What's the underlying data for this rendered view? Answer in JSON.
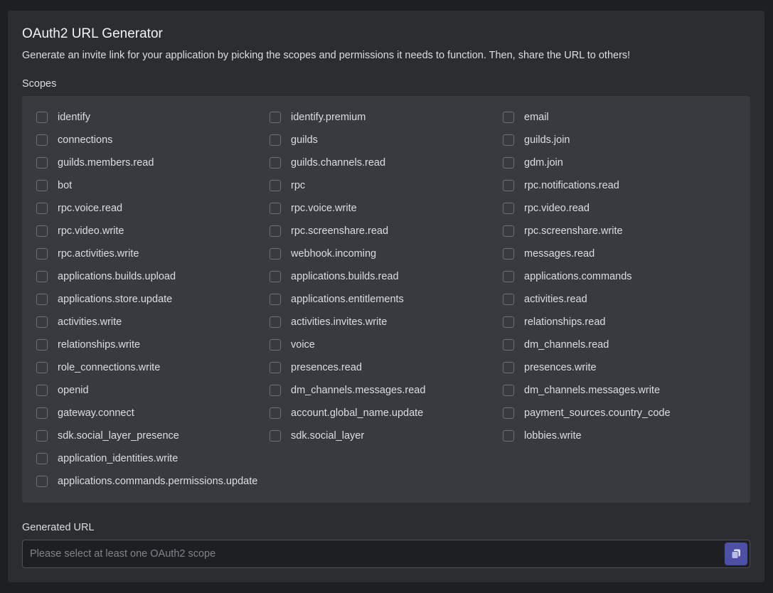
{
  "header": {
    "title": "OAuth2 URL Generator",
    "description": "Generate an invite link for your application by picking the scopes and permissions it needs to function. Then, share the URL to others!"
  },
  "scopes": {
    "label": "Scopes",
    "columns": [
      [
        "identify",
        "connections",
        "guilds.members.read",
        "bot",
        "rpc.voice.read",
        "rpc.video.write",
        "rpc.activities.write",
        "applications.builds.upload",
        "applications.store.update",
        "activities.write",
        "relationships.write",
        "role_connections.write",
        "openid",
        "gateway.connect",
        "sdk.social_layer_presence",
        "application_identities.write",
        "applications.commands.permissions.update"
      ],
      [
        "identify.premium",
        "guilds",
        "guilds.channels.read",
        "rpc",
        "rpc.voice.write",
        "rpc.screenshare.read",
        "webhook.incoming",
        "applications.builds.read",
        "applications.entitlements",
        "activities.invites.write",
        "voice",
        "presences.read",
        "dm_channels.messages.read",
        "account.global_name.update",
        "sdk.social_layer"
      ],
      [
        "email",
        "guilds.join",
        "gdm.join",
        "rpc.notifications.read",
        "rpc.video.read",
        "rpc.screenshare.write",
        "messages.read",
        "applications.commands",
        "activities.read",
        "relationships.read",
        "dm_channels.read",
        "presences.write",
        "dm_channels.messages.write",
        "payment_sources.country_code",
        "lobbies.write"
      ]
    ]
  },
  "generated_url": {
    "label": "Generated URL",
    "placeholder": "Please select at least one OAuth2 scope",
    "value": ""
  },
  "icons": {
    "copy": "copy-icon"
  },
  "colors": {
    "page_bg": "#1e1f22",
    "card_bg": "#2b2d31",
    "scopes_bg": "#393a40",
    "accent": "#4e50a8"
  }
}
